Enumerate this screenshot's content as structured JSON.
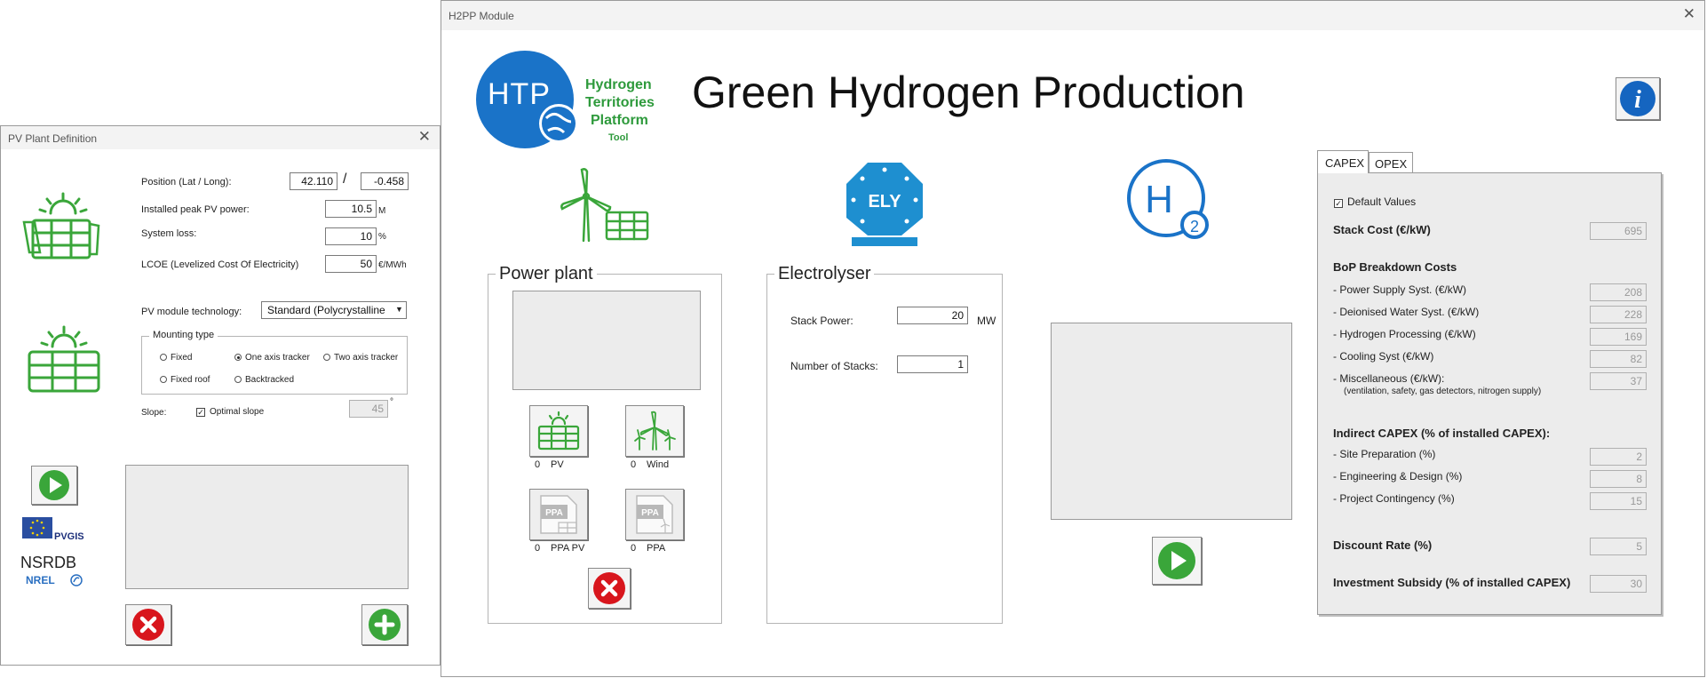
{
  "pv_window": {
    "title": "PV Plant Definition",
    "position_label": "Position (Lat / Long):",
    "lat": "42.110",
    "separator": "/",
    "long": "-0.458",
    "peak_power_label": "Installed peak PV power:",
    "peak_power_value": "10.5",
    "peak_power_unit": "M",
    "system_loss_label": "System loss:",
    "system_loss_value": "10",
    "system_loss_unit": "%",
    "lcoe_label": "LCOE (Levelized Cost Of Electricity)",
    "lcoe_value": "50",
    "lcoe_unit": "€/MWh",
    "module_tech_label": "PV module technology:",
    "module_tech_value": "Standard (Polycrystalline",
    "mounting_type_label": "Mounting type",
    "mounting_options": [
      "Fixed",
      "One axis tracker",
      "Two axis tracker",
      "Fixed roof",
      "Backtracked"
    ],
    "slope_label": "Slope:",
    "optimal_slope_label": "Optimal slope",
    "slope_value": "45",
    "slope_unit": "°",
    "pvgis_label": "PVGIS",
    "nsrdb_label": "NSRDB",
    "nrel_label": "NREL"
  },
  "h2pp": {
    "title": "H2PP Module",
    "logo_htp": "HTP",
    "logo_text_line1": "Hydrogen",
    "logo_text_line2": "Territories",
    "logo_text_line3": "Platform",
    "logo_text_line4": "Tool",
    "main_title": "Green Hydrogen Production",
    "ely_label": "ELY",
    "h2_label": "H",
    "h2_sub": "2",
    "info_icon": "i",
    "power_plant": {
      "legend": "Power plant",
      "pv_count": "0",
      "pv_label": "PV",
      "wind_count": "0",
      "wind_label": "Wind",
      "ppa_pv_count": "0",
      "ppa_pv_label": "PPA PV",
      "ppa_count": "0",
      "ppa_label": "PPA",
      "ppa_icon_text": "PPA"
    },
    "electrolyser": {
      "legend": "Electrolyser",
      "stack_power_label": "Stack Power:",
      "stack_power_value": "20",
      "stack_power_unit": "MW",
      "num_stacks_label": "Number of Stacks:",
      "num_stacks_value": "1"
    },
    "tabs": [
      "CAPEX",
      "OPEX"
    ],
    "capex": {
      "default_values_label": "Default Values",
      "stack_cost_label": "Stack Cost (€/kW)",
      "stack_cost_value": "695",
      "bop_title": "BoP Breakdown Costs",
      "power_supply_label": "- Power Supply Syst. (€/kW)",
      "power_supply_value": "208",
      "deionised_label": "- Deionised Water Syst. (€/kW)",
      "deionised_value": "228",
      "h2_processing_label": "- Hydrogen Processing (€/kW)",
      "h2_processing_value": "169",
      "cooling_label": "- Cooling Syst (€/kW)",
      "cooling_value": "82",
      "misc_label": "- Miscellaneous (€/kW):",
      "misc_note": "(ventilation, safety, gas detectors, nitrogen supply)",
      "misc_value": "37",
      "indirect_title": "Indirect CAPEX (% of installed CAPEX):",
      "site_prep_label": "- Site Preparation (%)",
      "site_prep_value": "2",
      "engineering_label": "- Engineering & Design (%)",
      "engineering_value": "8",
      "contingency_label": "- Project Contingency (%)",
      "contingency_value": "15",
      "discount_label": "Discount Rate (%)",
      "discount_value": "5",
      "subsidy_label": "Investment Subsidy (% of installed CAPEX)",
      "subsidy_value": "30"
    }
  },
  "colors": {
    "green": "#3aa63a",
    "blue": "#1a73c8",
    "ely_blue": "#1e8fd0",
    "red": "#d8161d"
  }
}
